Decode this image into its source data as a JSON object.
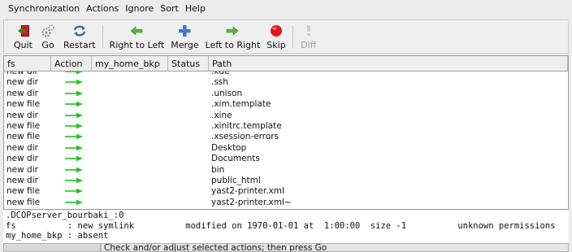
{
  "menu": [
    "Synchronization",
    "Actions",
    "Ignore",
    "Sort",
    "Help"
  ],
  "toolbar": {
    "quit": "Quit",
    "go": "Go",
    "restart": "Restart",
    "right_to_left": "Right to Left",
    "merge": "Merge",
    "left_to_right": "Left to Right",
    "skip": "Skip",
    "diff": "Diff"
  },
  "table": {
    "headers": [
      "fs",
      "Action",
      "my_home_bkp",
      "Status",
      "Path"
    ],
    "rows": [
      [
        "new dir",
        ".kde"
      ],
      [
        "new dir",
        ".ssh"
      ],
      [
        "new dir",
        ".unison"
      ],
      [
        "new file",
        ".xim.template"
      ],
      [
        "new dir",
        ".xine"
      ],
      [
        "new file",
        ".xinitrc.template"
      ],
      [
        "new file",
        ".xsession-errors"
      ],
      [
        "new dir",
        "Desktop"
      ],
      [
        "new dir",
        "Documents"
      ],
      [
        "new dir",
        "bin"
      ],
      [
        "new dir",
        "public_html"
      ],
      [
        "new file",
        "yast2-printer.xml"
      ],
      [
        "new file",
        "yast2-printer.xml~"
      ]
    ]
  },
  "details": {
    "line1": ".DCOPserver_bourbaki_:0",
    "line2": "fs          : new symlink          modified on 1970-01-01 at  1:00:00  size -1          unknown permissions",
    "line3": "my_home_bkp : absent"
  },
  "status": "Check and/or adjust selected actions; then press Go",
  "colors": {
    "arrow": "#22c322",
    "quit": "#c02020",
    "go": "#909090",
    "restart": "#3a6aa8",
    "rtl": "#56b43c",
    "merge": "#3b78d8",
    "ltr": "#56b43c",
    "skip": "#e01818",
    "diff": "#c8c8c8"
  }
}
